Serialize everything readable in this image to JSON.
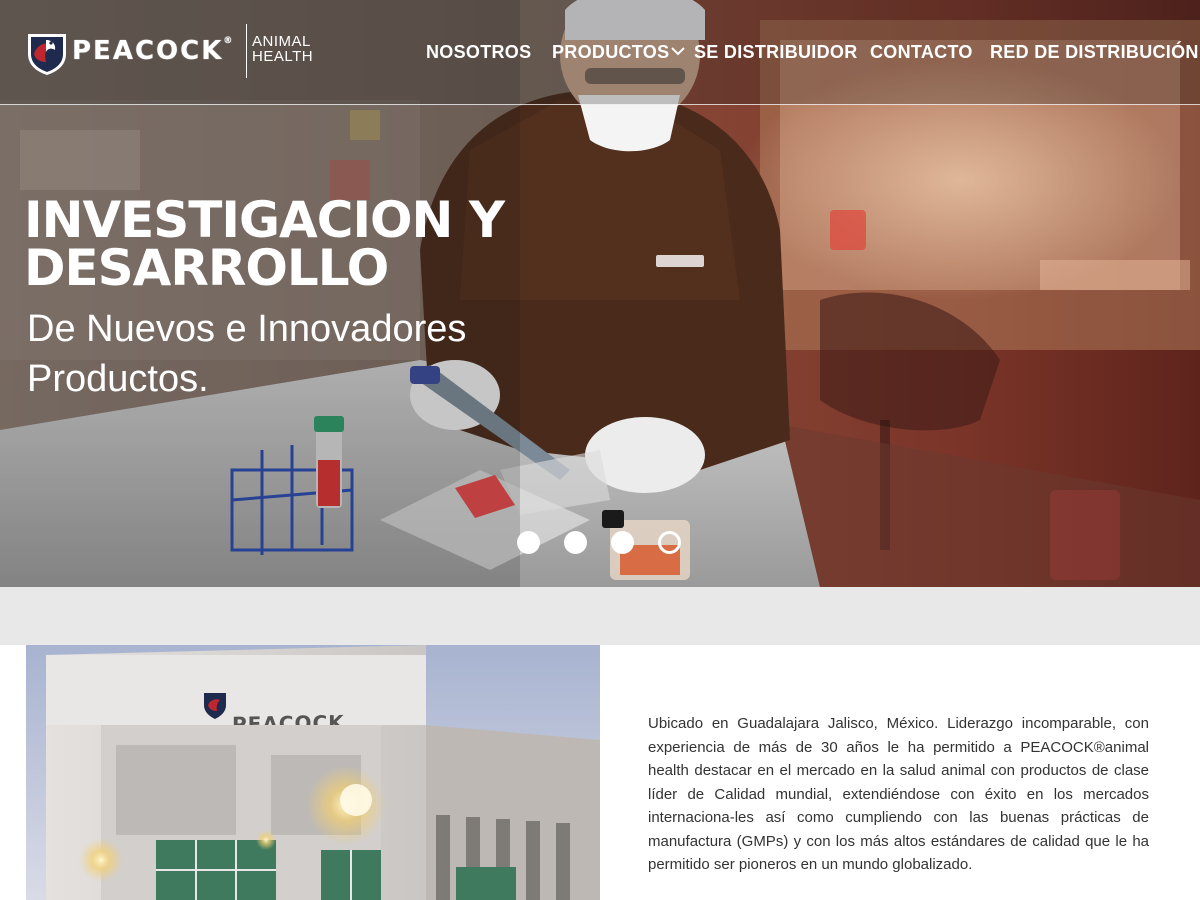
{
  "brand": {
    "name": "PEACOCK",
    "mark": "®",
    "sub_line1": "ANIMAL",
    "sub_line2": "HEALTH",
    "building_sign": "PEACOCK"
  },
  "nav": {
    "items": [
      {
        "label": "NOSOTROS"
      },
      {
        "label": "PRODUCTOS",
        "icon": "chevron-down-icon"
      },
      {
        "label": "SE DISTRIBUIDOR"
      },
      {
        "label": "CONTACTO"
      },
      {
        "label": "RED DE DISTRIBUCIÓN"
      }
    ]
  },
  "hero": {
    "title": "INVESTIGACION Y DESARROLLO",
    "subtitle": "De Nuevos e Innovadores Productos.",
    "slides": 4,
    "active_slide": 4
  },
  "about": {
    "text": "Ubicado en Guadalajara Jalisco, México. Liderazgo incomparable, con experiencia de más de 30 años le ha permitido a PEACOCK®animal health destacar en el mercado en la salud animal con productos de clase líder de Calidad mundial, extendiéndose con éxito en los mercados internaciona-les así como cumpliendo con las buenas prácticas de manufactura (GMPs) y con los más altos estándares de calidad que le ha permitido ser pioneros en un mundo globalizado."
  },
  "colors": {
    "nav_text": "#ffffff",
    "body_text": "#333333",
    "band_gray": "#e8e8e8",
    "emblem_navy": "#1f2a4f",
    "emblem_red": "#c0262d"
  }
}
